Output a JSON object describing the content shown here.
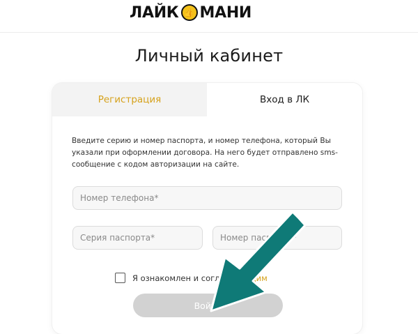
{
  "header": {
    "logo_left": "ЛАЙК",
    "logo_right": "МАНИ",
    "logo_coin_glyph": "👍"
  },
  "page": {
    "title": "Личный кабинет"
  },
  "tabs": [
    {
      "label": "Регистрация",
      "active": false
    },
    {
      "label": "Вход в ЛК",
      "active": true
    }
  ],
  "form": {
    "intro": "Введите серию и номер паспорта, и номер телефона, который Вы указали при оформлении договора. На него будет отправлено sms-сообщение с кодом авторизации на сайте.",
    "phone_placeholder": "Номер телефона*",
    "passport_series_placeholder": "Серия паспорта*",
    "passport_number_placeholder": "Номер паспорта*",
    "consent_text": "Я ознакомлен и согласен",
    "consent_link": "ющим",
    "submit_label": "Войти"
  },
  "colors": {
    "accent": "#d6a21c",
    "arrow": "#0f7a77",
    "button_disabled": "#d2d2d2"
  }
}
